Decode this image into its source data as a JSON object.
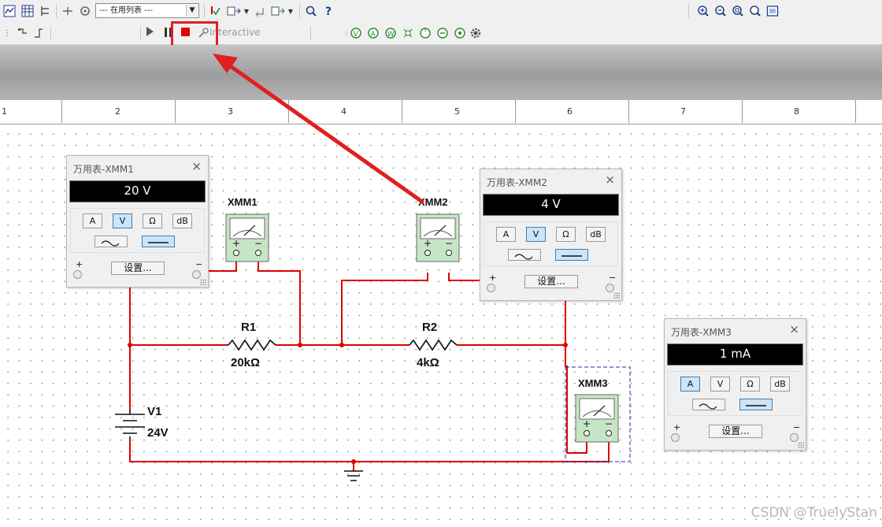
{
  "toolbar": {
    "scope_select": "--- 在用列表 ---",
    "interactive_label": "Interactive"
  },
  "ruler": [
    "1",
    "2",
    "3",
    "4",
    "5",
    "6",
    "7",
    "8"
  ],
  "schematic": {
    "r1": {
      "name": "R1",
      "value": "20kΩ"
    },
    "r2": {
      "name": "R2",
      "value": "4kΩ"
    },
    "v1": {
      "name": "V1",
      "value": "24V"
    },
    "xmm1": "XMM1",
    "xmm2": "XMM2",
    "xmm3": "XMM3",
    "plus": "+",
    "minus": "−"
  },
  "multimeters": [
    {
      "title": "万用表-XMM1",
      "reading": "20 V",
      "active_mode": "V",
      "wave": "dc"
    },
    {
      "title": "万用表-XMM2",
      "reading": "4 V",
      "active_mode": "V",
      "wave": "dc"
    },
    {
      "title": "万用表-XMM3",
      "reading": "1 mA",
      "active_mode": "A",
      "wave": "dc"
    }
  ],
  "mm_labels": {
    "a": "A",
    "v": "V",
    "ohm": "Ω",
    "db": "dB",
    "settings": "设置...",
    "plus": "+",
    "minus": "−",
    "close": "×"
  },
  "watermark": "CSDN @TruelyStan",
  "colors": {
    "wire": "#e00000",
    "highlight": "#e02020",
    "meter_body": "#c6e5c5"
  }
}
